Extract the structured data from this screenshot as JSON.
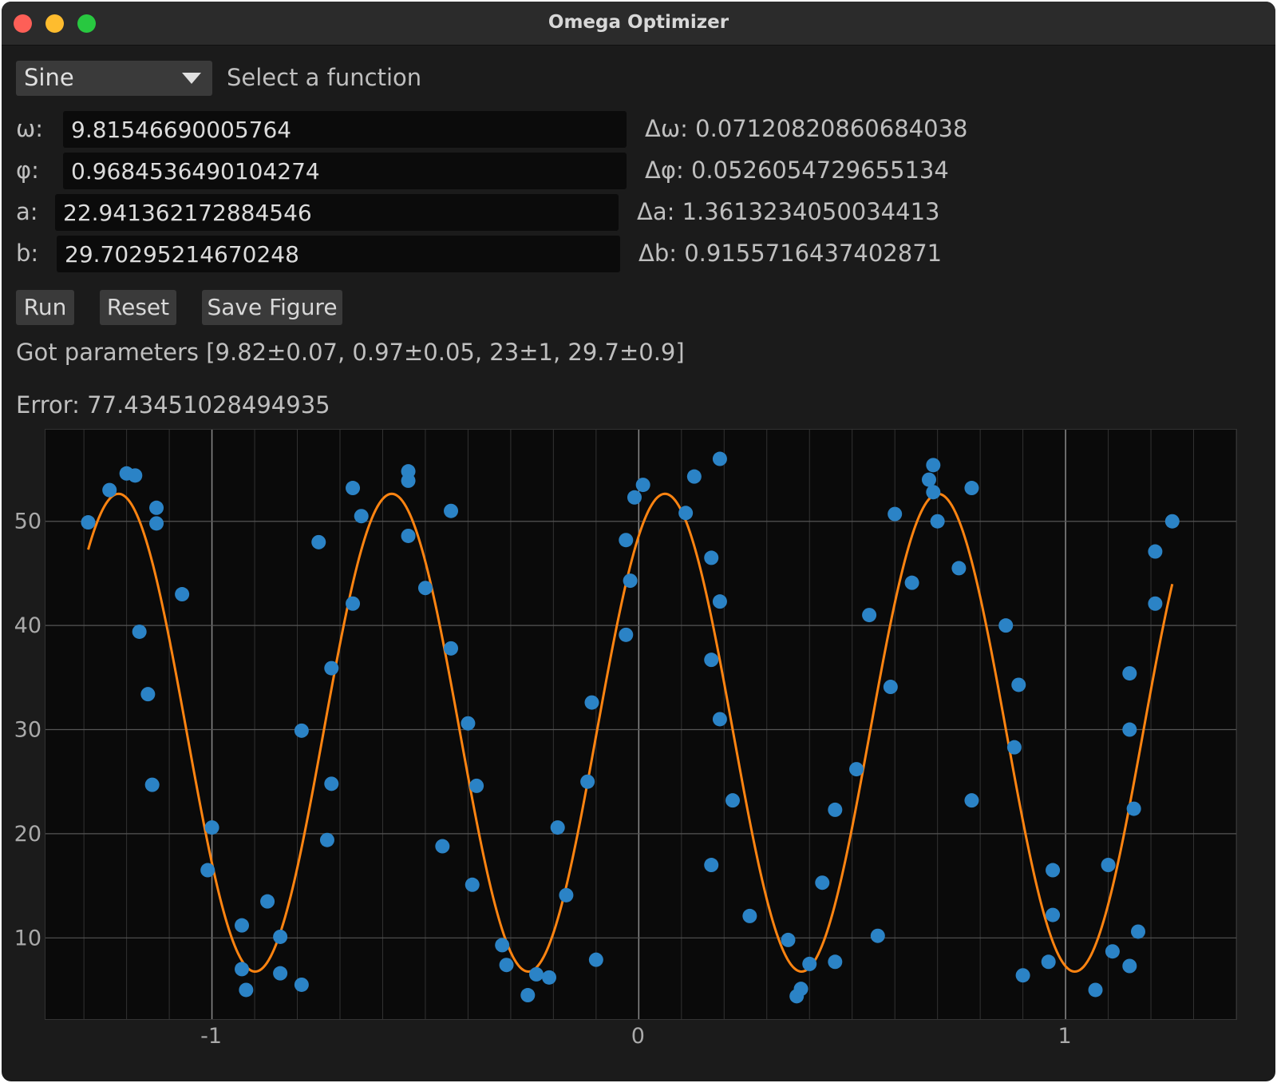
{
  "window": {
    "title": "Omega Optimizer"
  },
  "function_select": {
    "value": "Sine",
    "hint": "Select a function"
  },
  "params": [
    {
      "label": "ω:",
      "value": "9.81546690005764",
      "delta": "Δω: 0.07120820860684038"
    },
    {
      "label": "φ:",
      "value": "0.9684536490104274",
      "delta": "Δφ: 0.0526054729655134"
    },
    {
      "label": "a:",
      "value": "22.941362172884546",
      "delta": "Δa: 1.3613234050034413"
    },
    {
      "label": "b:",
      "value": "29.70295214670248",
      "delta": "Δb: 0.9155716437402871"
    }
  ],
  "buttons": {
    "run": "Run",
    "reset": "Reset",
    "save_figure": "Save Figure"
  },
  "status": {
    "result": "Got parameters [9.82±0.07, 0.97±0.05, 23±1, 29.7±0.9]",
    "error": "Error: 77.43451028494935"
  },
  "colors": {
    "points": "#2b83c6",
    "fit": "#ff8411",
    "accent": "#3a3a3a"
  },
  "chart_data": {
    "type": "scatter",
    "xlim": [
      -1.39,
      1.4
    ],
    "ylim": [
      2.2,
      58.8
    ],
    "x_ticks": [
      -1,
      0,
      1
    ],
    "x_tick_labels": [
      "-1",
      "0",
      "1"
    ],
    "y_ticks": [
      10,
      20,
      30,
      40,
      50
    ],
    "y_tick_labels": [
      "10",
      "20",
      "30",
      "40",
      "50"
    ],
    "grid": true,
    "fit_curve": {
      "omega": 9.81546690005764,
      "phi": 0.9684536490104274,
      "a": 22.941362172884546,
      "b": 29.70295214670248,
      "x_range": [
        -1.29,
        1.25
      ]
    },
    "points": [
      [
        -1.29,
        49.9
      ],
      [
        -1.24,
        53
      ],
      [
        -1.2,
        54.6
      ],
      [
        -1.18,
        54.4
      ],
      [
        -1.17,
        39.4
      ],
      [
        -1.15,
        33.4
      ],
      [
        -1.14,
        24.7
      ],
      [
        -1.13,
        51.3
      ],
      [
        -1.13,
        49.8
      ],
      [
        -1.07,
        43
      ],
      [
        -1.01,
        16.5
      ],
      [
        -1,
        20.6
      ],
      [
        -0.93,
        11.2
      ],
      [
        -0.93,
        7
      ],
      [
        -0.92,
        5
      ],
      [
        -0.87,
        13.5
      ],
      [
        -0.84,
        10.1
      ],
      [
        -0.84,
        6.6
      ],
      [
        -0.79,
        29.9
      ],
      [
        -0.79,
        5.5
      ],
      [
        -0.75,
        48
      ],
      [
        -0.73,
        19.4
      ],
      [
        -0.72,
        35.9
      ],
      [
        -0.72,
        24.8
      ],
      [
        -0.67,
        42.1
      ],
      [
        -0.67,
        53.2
      ],
      [
        -0.65,
        50.5
      ],
      [
        -0.54,
        54.8
      ],
      [
        -0.54,
        53.9
      ],
      [
        -0.54,
        48.6
      ],
      [
        -0.5,
        43.6
      ],
      [
        -0.46,
        18.8
      ],
      [
        -0.44,
        51
      ],
      [
        -0.44,
        37.8
      ],
      [
        -0.4,
        30.6
      ],
      [
        -0.39,
        15.1
      ],
      [
        -0.38,
        24.6
      ],
      [
        -0.32,
        9.3
      ],
      [
        -0.31,
        7.4
      ],
      [
        -0.26,
        4.5
      ],
      [
        -0.24,
        6.5
      ],
      [
        -0.21,
        6.2
      ],
      [
        -0.19,
        20.6
      ],
      [
        -0.17,
        14.1
      ],
      [
        -0.12,
        25
      ],
      [
        -0.1,
        7.9
      ],
      [
        -0.11,
        32.6
      ],
      [
        -0.03,
        48.2
      ],
      [
        -0.03,
        39.1
      ],
      [
        -0.02,
        44.3
      ],
      [
        -0.01,
        52.3
      ],
      [
        0.01,
        53.5
      ],
      [
        0.11,
        50.8
      ],
      [
        0.13,
        54.3
      ],
      [
        0.17,
        46.5
      ],
      [
        0.17,
        36.7
      ],
      [
        0.17,
        17
      ],
      [
        0.19,
        42.3
      ],
      [
        0.19,
        31
      ],
      [
        0.19,
        56
      ],
      [
        0.22,
        23.2
      ],
      [
        0.26,
        12.1
      ],
      [
        0.35,
        9.8
      ],
      [
        0.37,
        4.4
      ],
      [
        0.38,
        5.1
      ],
      [
        0.4,
        7.5
      ],
      [
        0.43,
        15.3
      ],
      [
        0.46,
        22.3
      ],
      [
        0.46,
        7.7
      ],
      [
        0.51,
        26.2
      ],
      [
        0.54,
        41
      ],
      [
        0.56,
        10.2
      ],
      [
        0.59,
        34.1
      ],
      [
        0.6,
        50.7
      ],
      [
        0.64,
        44.1
      ],
      [
        0.68,
        54
      ],
      [
        0.69,
        55.4
      ],
      [
        0.69,
        52.8
      ],
      [
        0.7,
        50
      ],
      [
        0.75,
        45.5
      ],
      [
        0.78,
        53.2
      ],
      [
        0.78,
        23.2
      ],
      [
        0.86,
        40
      ],
      [
        0.88,
        28.3
      ],
      [
        0.89,
        34.3
      ],
      [
        0.9,
        6.4
      ],
      [
        0.96,
        7.7
      ],
      [
        0.97,
        12.2
      ],
      [
        0.97,
        16.5
      ],
      [
        1.07,
        5
      ],
      [
        1.1,
        17
      ],
      [
        1.11,
        8.7
      ],
      [
        1.15,
        7.3
      ],
      [
        1.15,
        35.4
      ],
      [
        1.15,
        30
      ],
      [
        1.16,
        22.4
      ],
      [
        1.17,
        10.6
      ],
      [
        1.21,
        47.1
      ],
      [
        1.21,
        42.1
      ],
      [
        1.25,
        50
      ]
    ]
  }
}
